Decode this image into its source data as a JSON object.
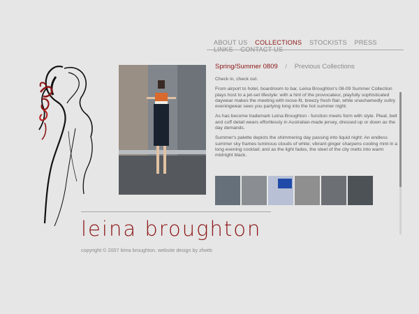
{
  "nav": {
    "items": [
      {
        "label": "ABOUT US",
        "active": false
      },
      {
        "label": "COLLECTIONS",
        "active": true
      },
      {
        "label": "STOCKISTS",
        "active": false
      },
      {
        "label": "PRESS",
        "active": false
      },
      {
        "label": "LINKS",
        "active": false
      },
      {
        "label": "CONTACT US",
        "active": false
      }
    ]
  },
  "collections": {
    "current": "Spring/Summer 0809",
    "separator": "/",
    "previous": "Previous Collections"
  },
  "content": {
    "p1": "Check in, check out.",
    "p2": "From airport to hotel, boardroom to bar, Leina Broughton's 08-09 Summer Collection plays host to a jet-set lifestyle: with a hint of the provocateur, playfully sophisticated daywear makes the meeting with loose-fit, breezy fresh flair, while unashamedly sultry eveningwear sees you partying long into the hot summer night.",
    "p3": "As has become trademark Leina Broughton - function meets form with style. Pleat, belt and cuff detail wears effortlessly in Australian-made jersey, dressed up or down as the day demands.",
    "p4": "Summer's palette depicts the shimmering day passing into liquid night: An endless summer sky frames luminous clouds of white; vibrant ginger sharpens cooling mint in a long evening cocktail; and as the light fades, the steel of the city melts into warm midnight black."
  },
  "brand": {
    "name": "leina broughton",
    "copyright": "copyright © 2007 leina broughton. website design by zfweb"
  },
  "colors": {
    "background": "#e6e6e6",
    "accent": "#8b1414",
    "nav_text": "#8a8a8a"
  },
  "thumbnails": [
    "thumbnail-1",
    "thumbnail-2",
    "thumbnail-3",
    "thumbnail-4",
    "thumbnail-5",
    "thumbnail-6"
  ]
}
